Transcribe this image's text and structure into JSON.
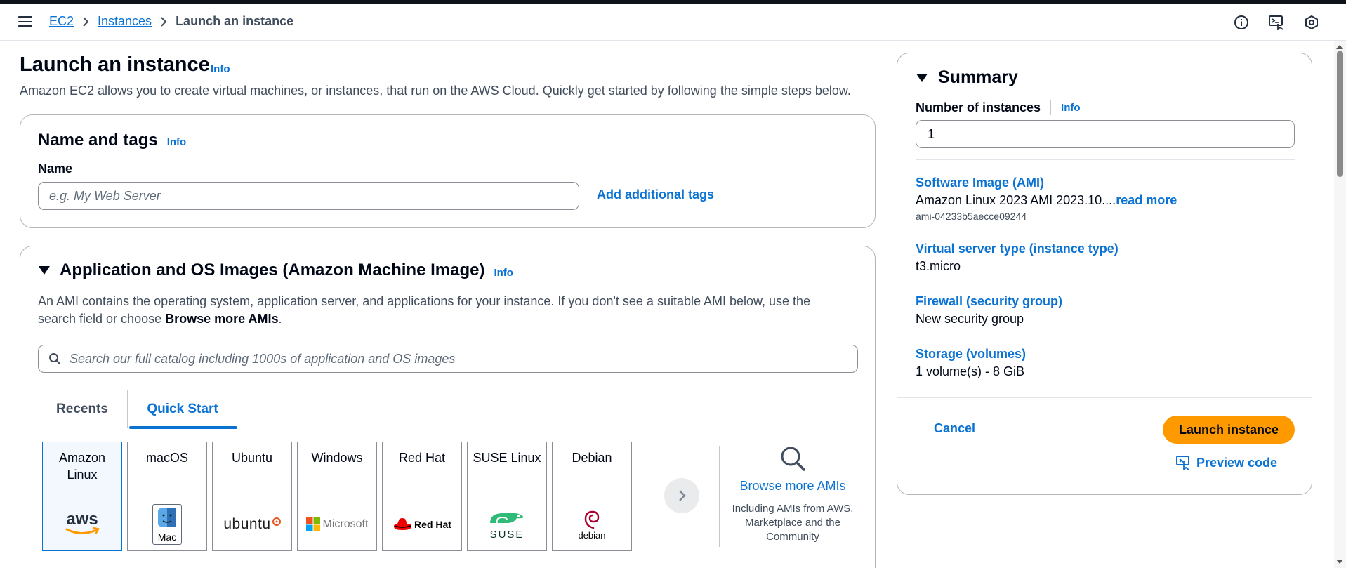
{
  "breadcrumb": {
    "ec2": "EC2",
    "instances": "Instances",
    "current": "Launch an instance"
  },
  "page": {
    "title": "Launch an instance",
    "info": "Info",
    "description": "Amazon EC2 allows you to create virtual machines, or instances, that run on the AWS Cloud. Quickly get started by following the simple steps below."
  },
  "name_tags": {
    "title": "Name and tags",
    "info": "Info",
    "name_label": "Name",
    "name_placeholder": "e.g. My Web Server",
    "add_tags": "Add additional tags"
  },
  "ami": {
    "title": "Application and OS Images (Amazon Machine Image)",
    "info": "Info",
    "desc_prefix": "An AMI contains the operating system, application server, and applications for your instance. If you don't see a suitable AMI below, use the search field or choose ",
    "desc_bold": "Browse more AMIs",
    "desc_suffix": ".",
    "search_placeholder": "Search our full catalog including 1000s of application and OS images",
    "tabs": {
      "recents": "Recents",
      "quick_start": "Quick Start"
    },
    "tiles": [
      {
        "name": "Amazon Linux",
        "logo": "aws-logo"
      },
      {
        "name": "macOS",
        "logo": "mac-logo",
        "logo_text": "Mac"
      },
      {
        "name": "Ubuntu",
        "logo": "ubuntu-logo",
        "logo_text": "ubuntu"
      },
      {
        "name": "Windows",
        "logo": "microsoft-logo",
        "logo_text": "Microsoft"
      },
      {
        "name": "Red Hat",
        "logo": "redhat-logo",
        "logo_text": "Red Hat"
      },
      {
        "name": "SUSE Linux",
        "logo": "suse-logo",
        "logo_text": "SUSE"
      },
      {
        "name": "Debian",
        "logo": "debian-logo",
        "logo_text": "debian"
      }
    ],
    "browse_more": "Browse more AMIs",
    "browse_sub": "Including AMIs from AWS, Marketplace and the Community"
  },
  "summary": {
    "title": "Summary",
    "num_instances_label": "Number of instances",
    "info": "Info",
    "num_instances_value": "1",
    "software_label": "Software Image (AMI)",
    "software_value": "Amazon Linux 2023 AMI 2023.10....",
    "read_more": "read more",
    "ami_id": "ami-04233b5aecce09244",
    "server_type_label": "Virtual server type (instance type)",
    "server_type_value": "t3.micro",
    "firewall_label": "Firewall (security group)",
    "firewall_value": "New security group",
    "storage_label": "Storage (volumes)",
    "storage_value": "1 volume(s) - 8 GiB",
    "cancel": "Cancel",
    "launch": "Launch instance",
    "preview_code": "Preview code"
  },
  "colors": {
    "link": "#0972d3",
    "launch_button": "#ff9900",
    "text": "#000716"
  }
}
